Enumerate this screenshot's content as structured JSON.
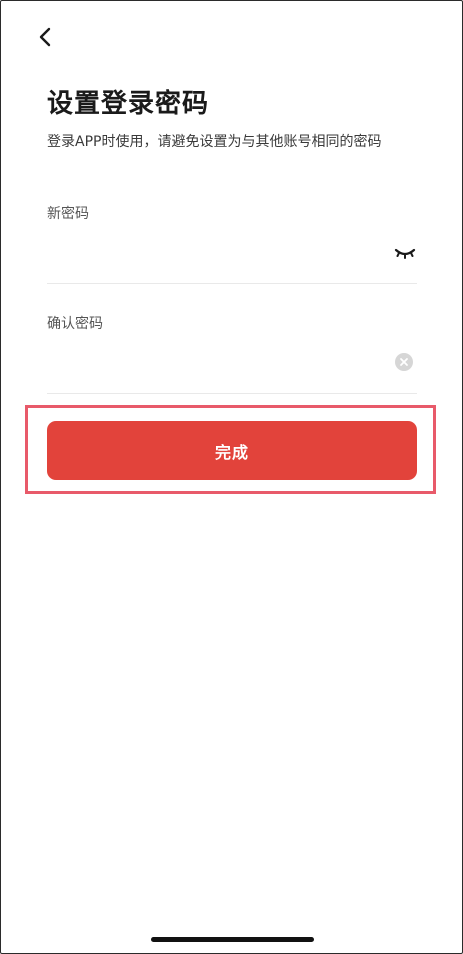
{
  "header": {
    "back_icon": "chevron-left-icon"
  },
  "page": {
    "title": "设置登录密码",
    "subtitle": "登录APP时使用，请避免设置为与其他账号相同的密码"
  },
  "form": {
    "new_password": {
      "label": "新密码",
      "value": "",
      "placeholder": "",
      "toggle_icon": "eye-closed-icon"
    },
    "confirm_password": {
      "label": "确认密码",
      "value": "",
      "placeholder": "",
      "clear_icon": "clear-circle-icon"
    },
    "submit_label": "完成"
  },
  "colors": {
    "accent": "#e2433b",
    "highlight": "#e85a6a"
  }
}
